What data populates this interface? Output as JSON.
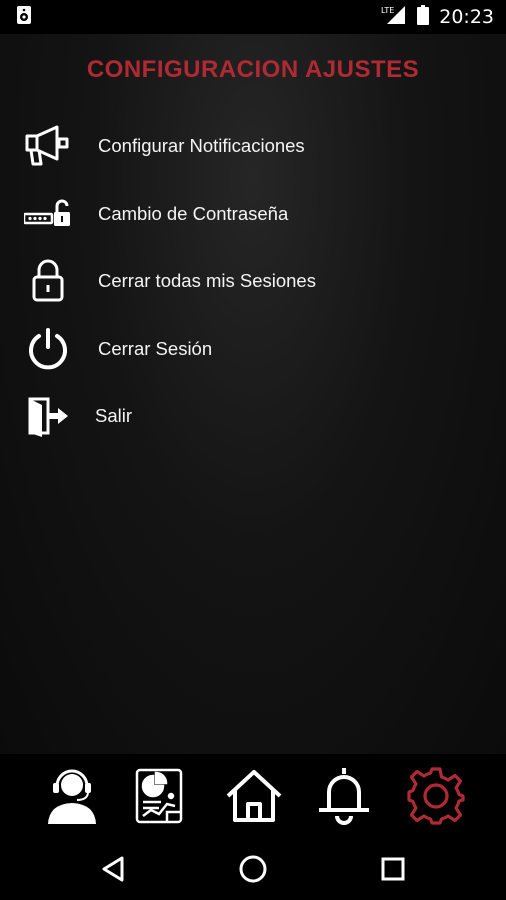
{
  "status_bar": {
    "time": "20:23",
    "network": "LTE",
    "icons": [
      "speaker-icon",
      "lte-signal-icon",
      "battery-icon"
    ]
  },
  "page": {
    "title": "CONFIGURACION AJUSTES",
    "title_color": "#b02a33"
  },
  "menu": {
    "items": [
      {
        "label": "Configurar Notificaciones",
        "icon": "megaphone-icon"
      },
      {
        "label": "Cambio de Contraseña",
        "icon": "password-unlock-icon"
      },
      {
        "label": "Cerrar todas mis Sesiones",
        "icon": "padlock-icon"
      },
      {
        "label": "Cerrar Sesión",
        "icon": "power-icon"
      },
      {
        "label": "Salir",
        "icon": "exit-door-icon"
      }
    ]
  },
  "bottom_nav": {
    "items": [
      "support-agent-icon",
      "report-chart-icon",
      "home-icon",
      "bell-icon",
      "gear-icon"
    ],
    "active": "gear-icon",
    "active_color": "#b02a33"
  },
  "system_nav": {
    "items": [
      "back-icon",
      "home-circle-icon",
      "recents-icon"
    ]
  }
}
